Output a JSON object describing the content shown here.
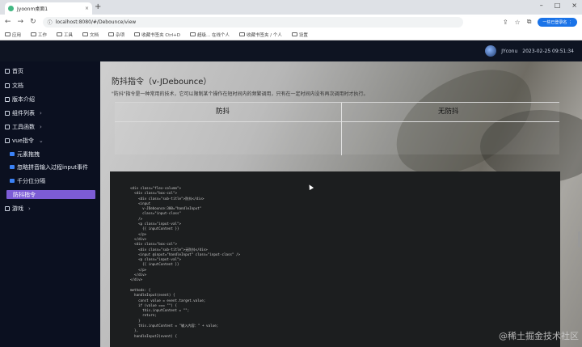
{
  "browser": {
    "tab_title": "Jyoonm桌面1",
    "url": "localhost:8080/#/Debounce/view",
    "profile_label": "一些已登录名 ⋮",
    "bookmarks": [
      "应用",
      "工作",
      "工具",
      "文档",
      "杂项",
      "收藏书签夹 Ctrl+D",
      "超级... 在线个人",
      "收藏书签夹 / 个人",
      "设置"
    ]
  },
  "header": {
    "username": "JYconu",
    "datetime": "2023-02-25 09:51:34"
  },
  "sidebar": {
    "items": [
      {
        "label": "首页"
      },
      {
        "label": "文档"
      },
      {
        "label": "版本介绍"
      },
      {
        "label": "组件列表"
      },
      {
        "label": "工具函数"
      },
      {
        "label": "vue指令"
      }
    ],
    "subitems": [
      {
        "label": "元素拖拽"
      },
      {
        "label": "忽略拼音输入过程input事件"
      },
      {
        "label": "千分位分隔"
      },
      {
        "label": "防抖指令"
      }
    ],
    "game": {
      "label": "游戏"
    }
  },
  "main": {
    "title": "防抖指令（v-JDebounce）",
    "description": "\"防抖\"指令是一种常用的技术，它可以限制某个操作在短时间内的频繁调用，只有在一定时间内没有再次调用时才执行。",
    "col_left": "防抖",
    "col_right": "无防抖",
    "code": "<div class=\"flex-column\">\n  <div class=\"box-col\">\n    <div class=\"sub-title\">防抖</div>\n    <input\n      v-JDebounce:300=\"handleInput\"\n      class=\"input-class\"\n    />\n    <p class=\"input-val\">\n      {{ inputContent }}\n    </p>\n  </div>\n  <div class=\"box-col\">\n    <div class=\"sub-title\">无防抖</div>\n    <input @input=\"handleInput\" class=\"input-class\" />\n    <p class=\"input-val\">\n      {{ inputContent }}\n    </p>\n  </div>\n</div>\n\nmethods: {\n  handleInput(event) {\n    const value = event.target.value;\n    if (value === \"\") {\n      this.inputContent = \"\";\n      return;\n    }\n    this.inputContent = \"输入内容：\" + value;\n  },\n  handleInput2(event) {"
  },
  "watermark": "@稀土掘金技术社区"
}
